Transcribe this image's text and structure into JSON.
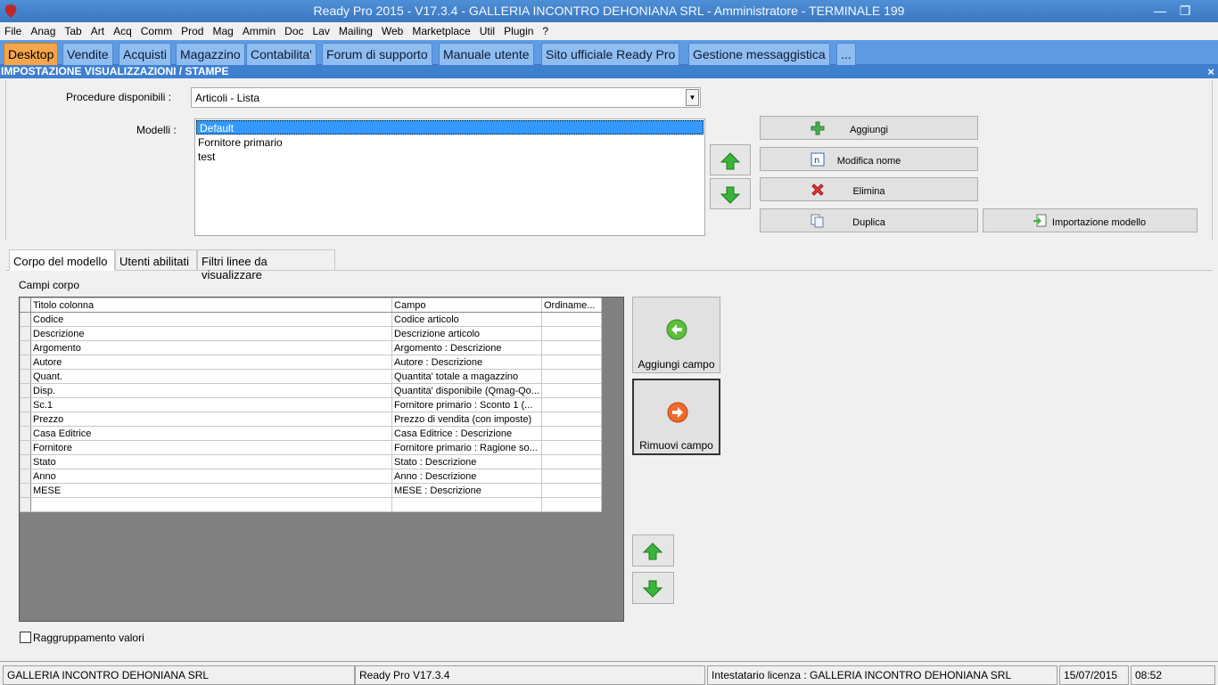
{
  "window": {
    "title": "Ready Pro 2015 - V17.3.4 - GALLERIA INCONTRO DEHONIANA SRL - Amministratore - TERMINALE 199"
  },
  "menu": [
    "File",
    "Anag",
    "Tab",
    "Art",
    "Acq",
    "Comm",
    "Prod",
    "Mag",
    "Ammin",
    "Doc",
    "Lav",
    "Mailing",
    "Web",
    "Marketplace",
    "Util",
    "Plugin",
    "?"
  ],
  "tabs": [
    "Desktop",
    "Vendite",
    "Acquisti",
    "Magazzino",
    "Contabilita'",
    "Forum di supporto",
    "Manuale utente",
    "Sito ufficiale Ready Pro",
    "Gestione messaggistica",
    "..."
  ],
  "panel": {
    "title": "IMPOSTAZIONE VISUALIZZAZIONI / STAMPE",
    "close": "×"
  },
  "procedure": {
    "label": "Procedure disponibili :",
    "value": "Articoli - Lista"
  },
  "models": {
    "label": "Modelli :",
    "items": [
      "Default",
      "Fornitore primario",
      "test"
    ],
    "selected": 0
  },
  "buttons": {
    "add": "Aggiungi",
    "rename": "Modifica nome",
    "delete": "Elimina",
    "duplicate": "Duplica",
    "import": "Importazione modello"
  },
  "subtabs": [
    "Corpo del modello",
    "Utenti abilitati",
    "Filtri linee da visualizzare"
  ],
  "fields_label": "Campi corpo",
  "grid": {
    "headers": [
      "Titolo colonna",
      "Campo",
      "Ordiname..."
    ],
    "rows": [
      [
        "Codice",
        "Codice articolo",
        ""
      ],
      [
        "Descrizione",
        "Descrizione articolo",
        ""
      ],
      [
        "Argomento",
        "Argomento : Descrizione",
        ""
      ],
      [
        "Autore",
        "Autore : Descrizione",
        ""
      ],
      [
        "Quant.",
        "Quantita' totale a magazzino",
        ""
      ],
      [
        "Disp.",
        "Quantita' disponibile (Qmag-Qo...",
        ""
      ],
      [
        "Sc.1",
        "Fornitore primario : Sconto 1 (...",
        ""
      ],
      [
        "Prezzo",
        "Prezzo di vendita (con imposte)",
        ""
      ],
      [
        "Casa Editrice",
        "Casa Editrice : Descrizione",
        ""
      ],
      [
        "Fornitore",
        "Fornitore primario : Ragione so...",
        ""
      ],
      [
        "Stato",
        "Stato : Descrizione",
        ""
      ],
      [
        "Anno",
        "Anno : Descrizione",
        ""
      ],
      [
        "MESE",
        "MESE : Descrizione",
        ""
      ],
      [
        "",
        "",
        ""
      ]
    ]
  },
  "field_buttons": {
    "add": "Aggiungi campo",
    "remove": "Rimuovi campo"
  },
  "grouping": {
    "label": "Raggruppamento valori",
    "checked": false
  },
  "status": {
    "company": "GALLERIA INCONTRO DEHONIANA SRL",
    "version": "Ready Pro V17.3.4",
    "license": "Intestatario licenza : GALLERIA INCONTRO DEHONIANA SRL",
    "date": "15/07/2015",
    "time": "08:52"
  }
}
